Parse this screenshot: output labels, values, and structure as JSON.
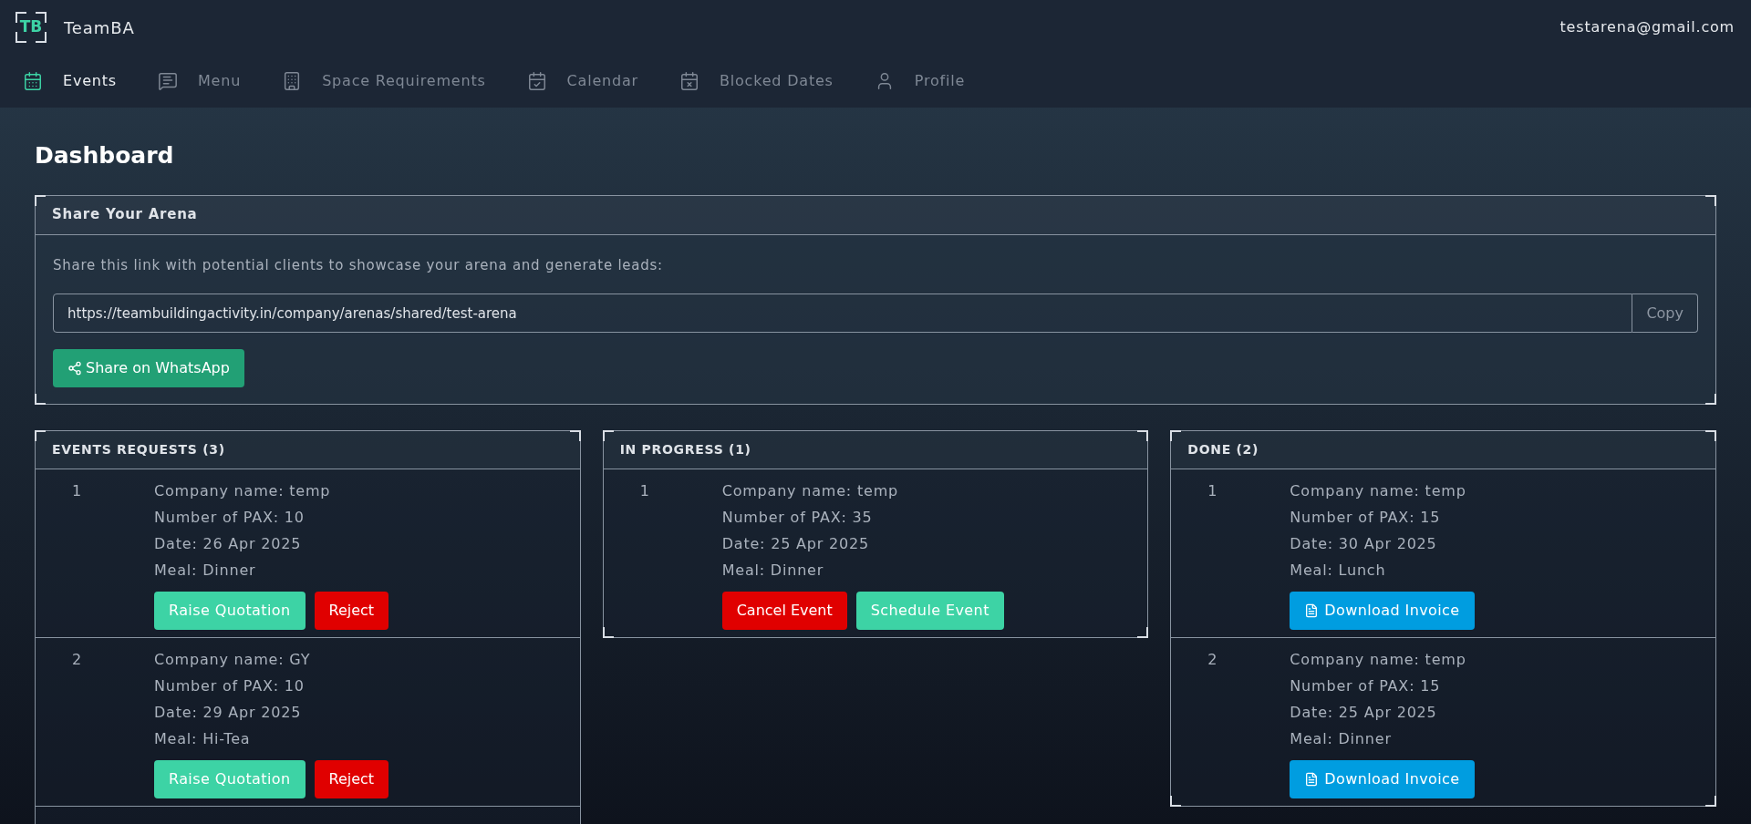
{
  "brand": {
    "logo": "TB",
    "name": "TeamBA"
  },
  "user_email": "testarena@gmail.com",
  "nav": [
    {
      "label": "Events",
      "selected": true
    },
    {
      "label": "Menu",
      "selected": false
    },
    {
      "label": "Space Requirements",
      "selected": false
    },
    {
      "label": "Calendar",
      "selected": false
    },
    {
      "label": "Blocked Dates",
      "selected": false
    },
    {
      "label": "Profile",
      "selected": false
    }
  ],
  "page_title": "Dashboard",
  "share": {
    "title": "Share Your Arena",
    "description": "Share this link with potential clients to showcase your arena and generate leads:",
    "link": "https://teambuildingactivity.in/company/arenas/shared/test-arena",
    "copy_label": "Copy",
    "whatsapp_label": "Share on WhatsApp"
  },
  "boards": [
    {
      "title": "EVENTS REQUESTS (3)",
      "items": [
        {
          "number": "1",
          "lines": [
            "Company name: temp",
            "Number of PAX: 10",
            "Date: 26 Apr 2025",
            "Meal: Dinner"
          ],
          "actions": [
            {
              "label": "Raise Quotation",
              "kind": "primary"
            },
            {
              "label": "Reject",
              "kind": "danger"
            }
          ]
        },
        {
          "number": "2",
          "lines": [
            "Company name: GY",
            "Number of PAX: 10",
            "Date: 29 Apr 2025",
            "Meal: Hi-Tea"
          ],
          "actions": [
            {
              "label": "Raise Quotation",
              "kind": "primary"
            },
            {
              "label": "Reject",
              "kind": "danger"
            }
          ]
        }
      ],
      "more_below": true
    },
    {
      "title": "IN PROGRESS (1)",
      "items": [
        {
          "number": "1",
          "lines": [
            "Company name: temp",
            "Number of PAX: 35",
            "Date: 25 Apr 2025",
            "Meal: Dinner"
          ],
          "actions": [
            {
              "label": "Cancel Event",
              "kind": "danger"
            },
            {
              "label": "Schedule Event",
              "kind": "primary"
            }
          ]
        }
      ],
      "more_below": false
    },
    {
      "title": "DONE (2)",
      "items": [
        {
          "number": "1",
          "lines": [
            "Company name: temp",
            "Number of PAX: 15",
            "Date: 30 Apr 2025",
            "Meal: Lunch"
          ],
          "actions": [
            {
              "label": "Download Invoice",
              "kind": "invoice"
            }
          ]
        },
        {
          "number": "2",
          "lines": [
            "Company name: temp",
            "Number of PAX: 15",
            "Date: 25 Apr 2025",
            "Meal: Dinner"
          ],
          "actions": [
            {
              "label": "Download Invoice",
              "kind": "invoice"
            }
          ]
        }
      ],
      "more_below": false
    }
  ]
}
